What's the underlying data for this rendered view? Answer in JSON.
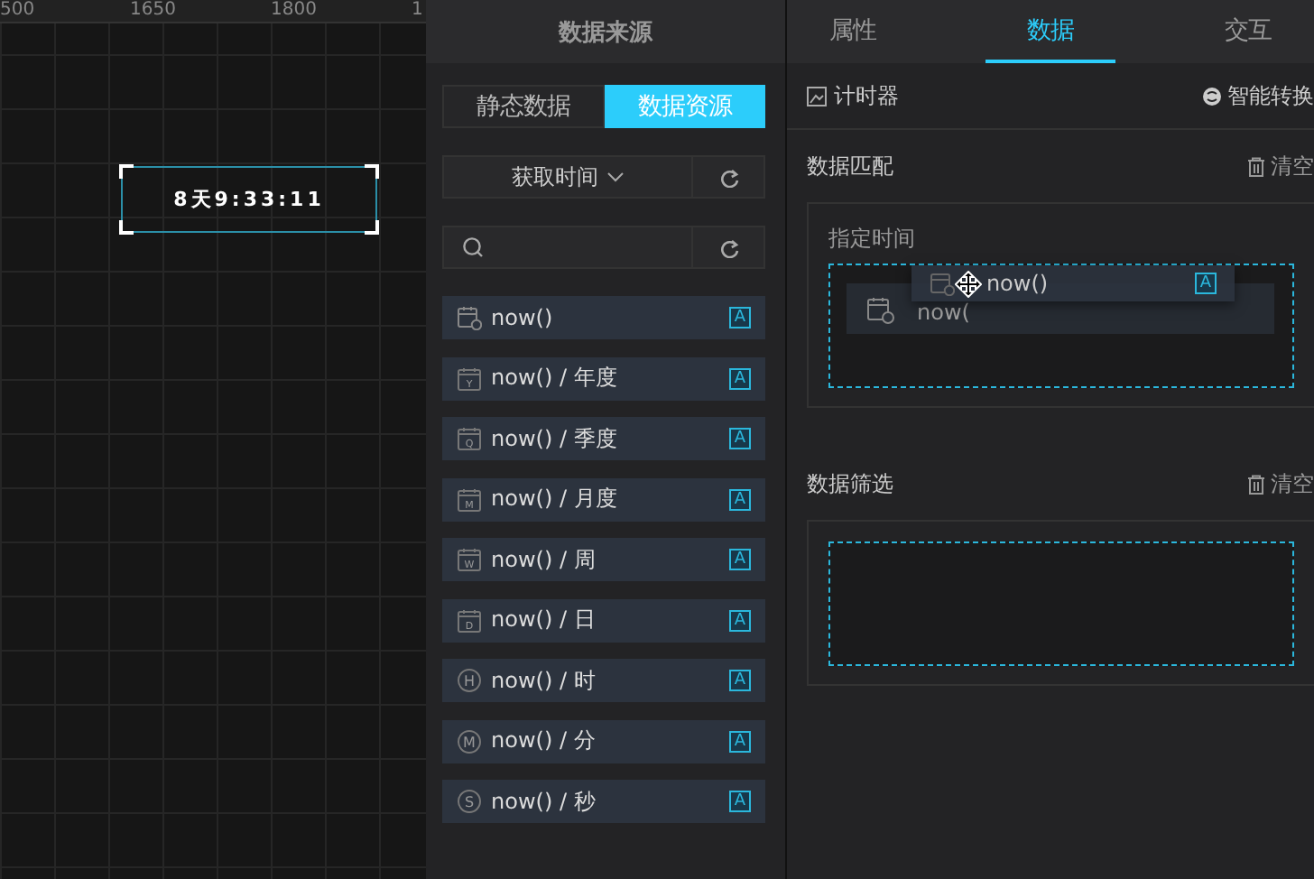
{
  "canvas": {
    "ruler_labels": [
      "500",
      "1650",
      "1800",
      "1"
    ],
    "timer_widget": {
      "text": "8天9:33:11",
      "selected": true
    }
  },
  "source_panel": {
    "title": "数据来源",
    "mode_toggle": [
      {
        "label": "静态数据",
        "selected": false
      },
      {
        "label": "数据资源",
        "selected": true
      }
    ],
    "dropdown": {
      "value": "获取时间"
    },
    "items": [
      {
        "kind": "timestamp",
        "label": "now()",
        "type": "A"
      },
      {
        "kind": "date",
        "icon_letter": "Y",
        "label": "now() / 年度",
        "type": "A"
      },
      {
        "kind": "date",
        "icon_letter": "Q",
        "label": "now() / 季度",
        "type": "A"
      },
      {
        "kind": "date",
        "icon_letter": "M",
        "label": "now() / 月度",
        "type": "A"
      },
      {
        "kind": "date",
        "icon_letter": "W",
        "label": "now() / 周",
        "type": "A"
      },
      {
        "kind": "date",
        "icon_letter": "D",
        "label": "now() / 日",
        "type": "A"
      },
      {
        "kind": "time",
        "icon_letter": "H",
        "label": "now() / 时",
        "type": "A"
      },
      {
        "kind": "time",
        "icon_letter": "M",
        "label": "now() / 分",
        "type": "A"
      },
      {
        "kind": "time",
        "icon_letter": "S",
        "label": "now() / 秒",
        "type": "A"
      }
    ]
  },
  "config_panel": {
    "tabs": [
      {
        "label": "属性",
        "selected": false
      },
      {
        "label": "数据",
        "selected": true
      },
      {
        "label": "交互",
        "selected": false
      }
    ],
    "component": "计时器",
    "smart_convert": "智能转换",
    "sections": [
      {
        "title": "数据匹配",
        "clear": "清空",
        "field_label": "指定时间",
        "preview_item": {
          "label": "now("
        },
        "drag_item": {
          "label": "now()",
          "type": "A"
        }
      },
      {
        "title": "数据筛选",
        "clear": "清空"
      }
    ]
  }
}
